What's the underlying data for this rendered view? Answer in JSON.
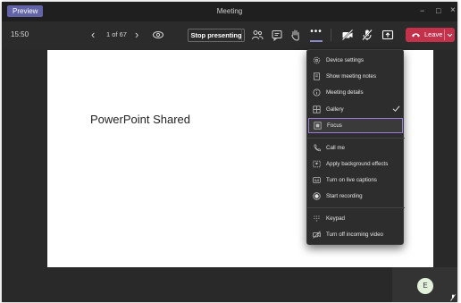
{
  "window": {
    "preview_badge": "Preview",
    "title": "Meeting",
    "minimize": "−",
    "maximize": "□",
    "close": "×"
  },
  "toolbar": {
    "time": "15:50",
    "prev_glyph": "‹",
    "next_glyph": "›",
    "slide_counter": "1 of 67",
    "stop_presenting": "Stop presenting",
    "more_label": "•••",
    "leave": "Leave",
    "icons": [
      "eye-icon",
      "people-icon",
      "chat-icon",
      "raise-hand-icon",
      "more-icon",
      "camera-off-icon",
      "mic-off-icon",
      "share-icon",
      "phone-icon",
      "chevron-down-icon"
    ]
  },
  "slide": {
    "title": "PowerPoint Shared"
  },
  "self_view": {
    "avatar_initial": "E"
  },
  "menu": {
    "items": [
      {
        "label": "Device settings",
        "icon": "gear-icon"
      },
      {
        "label": "Show meeting notes",
        "icon": "notes-icon"
      },
      {
        "label": "Meeting details",
        "icon": "info-icon"
      },
      {
        "label": "Gallery",
        "icon": "gallery-icon",
        "checked": true
      },
      {
        "label": "Focus",
        "icon": "focus-icon",
        "highlighted": true
      },
      {
        "label": "Call me",
        "icon": "phone-icon"
      },
      {
        "label": "Apply background effects",
        "icon": "background-effects-icon"
      },
      {
        "label": "Turn on live captions",
        "icon": "captions-icon"
      },
      {
        "label": "Start recording",
        "icon": "record-icon"
      },
      {
        "label": "Keypad",
        "icon": "keypad-icon"
      },
      {
        "label": "Turn off incoming video",
        "icon": "video-off-icon"
      }
    ]
  },
  "colors": {
    "accent": "#6264a7",
    "leave": "#c4314b",
    "focus_outline": "#9a7bd8",
    "background": "#292929"
  }
}
